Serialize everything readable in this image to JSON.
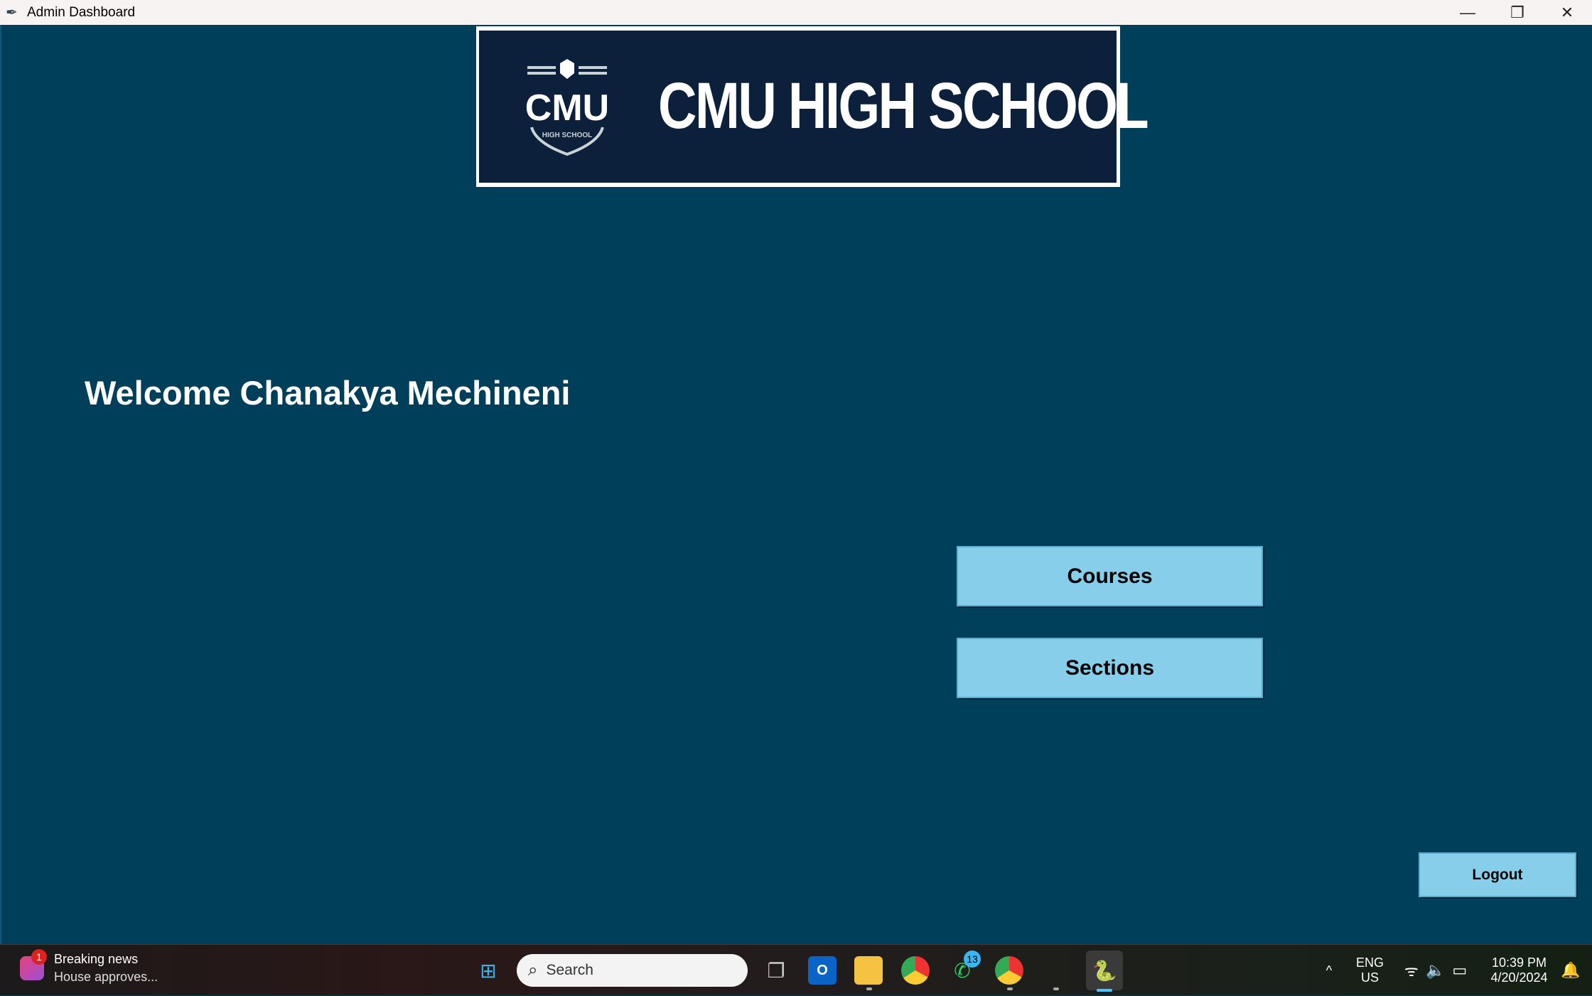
{
  "window": {
    "title": "Admin Dashboard",
    "minimize": "—",
    "restore": "❐",
    "close": "✕"
  },
  "logo": {
    "crest_text": "CMU",
    "crest_sub": "HIGH SCHOOL",
    "name": "CMU HIGH SCHOOL"
  },
  "welcome": "Welcome Chanakya Mechineni",
  "buttons": {
    "courses": "Courses",
    "sections": "Sections",
    "logout": "Logout"
  },
  "taskbar": {
    "news_title": "Breaking news",
    "news_sub": "House approves...",
    "news_badge": "1",
    "search_placeholder": "Search",
    "whatsapp_badge": "13",
    "lang1": "ENG",
    "lang2": "US",
    "time": "10:39 PM",
    "date": "4/20/2024"
  },
  "colors": {
    "background": "#003f59",
    "button": "#87ceeb",
    "logo_bg": "#0c1f3b"
  }
}
